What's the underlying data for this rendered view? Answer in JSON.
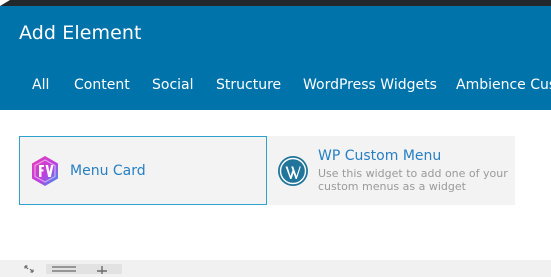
{
  "modal": {
    "title": "Add Element",
    "tabs": [
      "All",
      "Content",
      "Social",
      "Structure",
      "WordPress Widgets",
      "Ambience Cust"
    ]
  },
  "elements": [
    {
      "name": "Menu Card",
      "icon": "menu-card-icon",
      "selected": true
    },
    {
      "name": "WP Custom Menu",
      "description": "Use this widget to add one of your custom menus as a widget",
      "icon": "wordpress-icon",
      "selected": false
    }
  ],
  "colors": {
    "header": "#0073aa",
    "accent": "#2680c2",
    "selected_border": "#2ea2cc",
    "card_bg": "#f3f3f3"
  },
  "footer_icons": [
    "expand-icon",
    "hamburger-icon",
    "plus-icon"
  ]
}
